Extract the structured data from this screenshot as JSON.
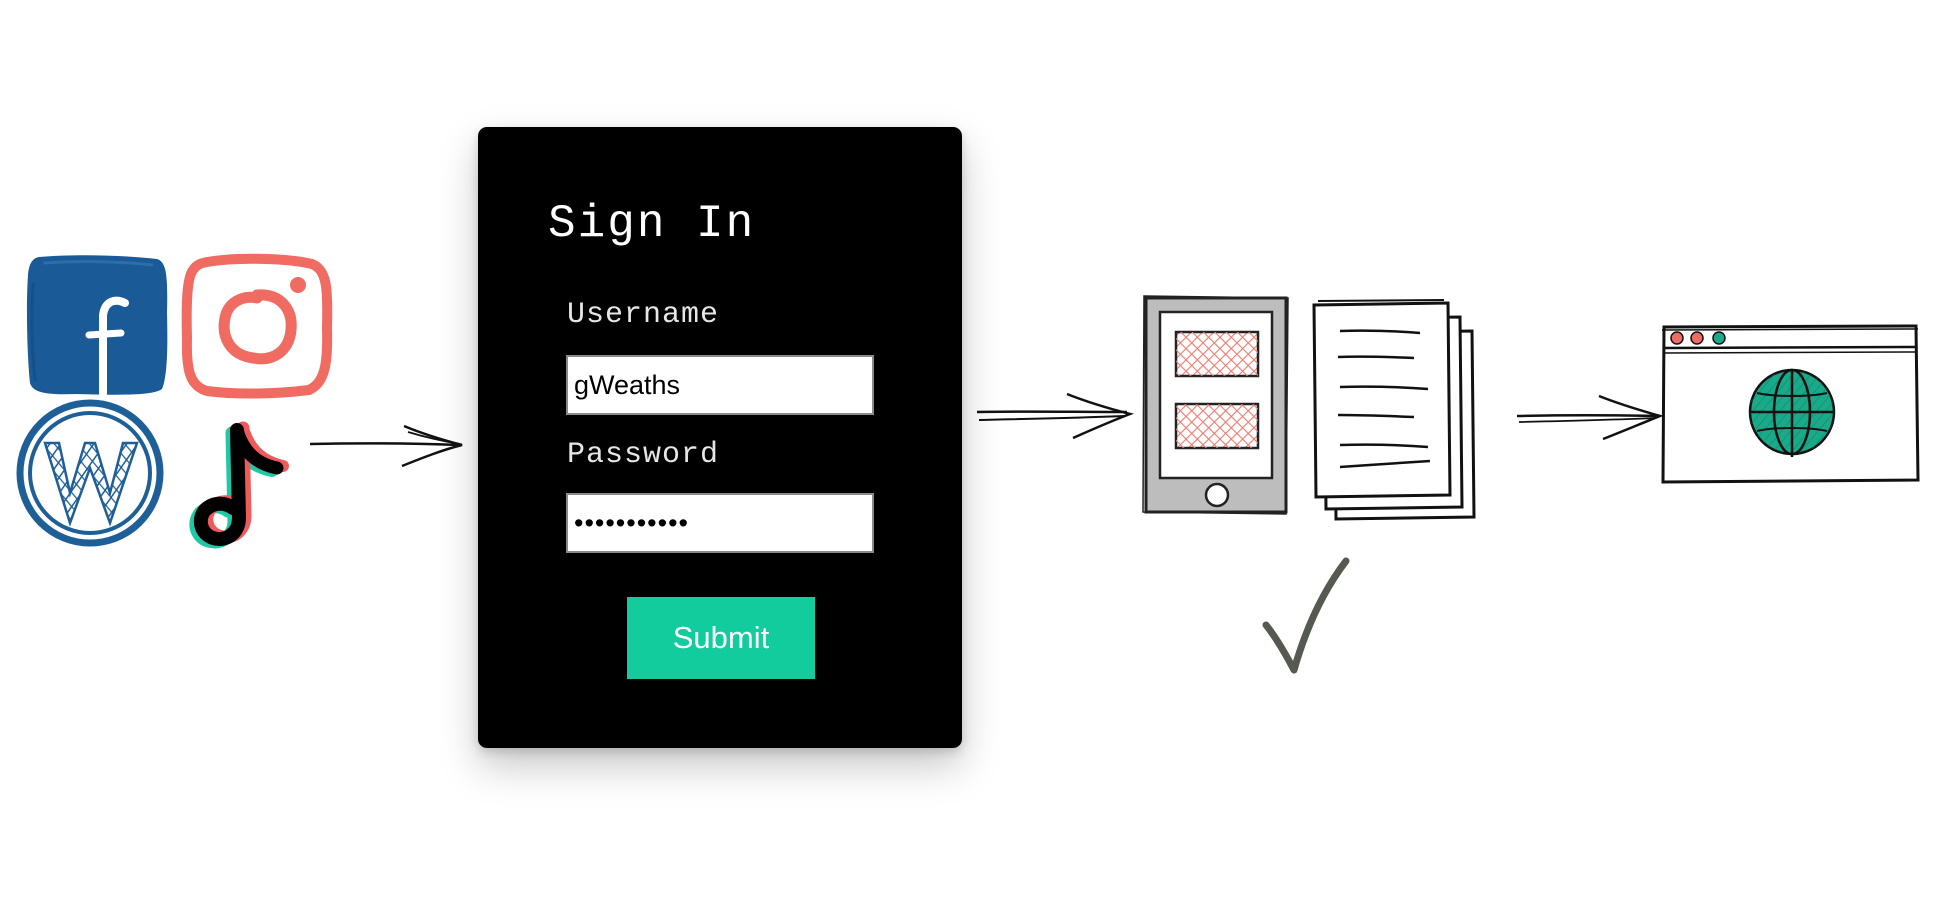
{
  "signin": {
    "title": "Sign In",
    "username_label": "Username",
    "username_value": "gWeaths",
    "password_label": "Password",
    "password_value": "•••••••••••",
    "submit_label": "Submit"
  },
  "icons": {
    "social": [
      "facebook-icon",
      "instagram-icon",
      "wordpress-icon",
      "tiktok-icon"
    ],
    "flow": [
      "arrow-right-icon",
      "tablet-icon",
      "documents-icon",
      "checkmark-icon",
      "browser-window-icon",
      "globe-icon"
    ]
  },
  "colors": {
    "facebook": "#1a5a96",
    "instagram": "#f06b62",
    "wordpress": "#1f5f98",
    "tiktok_black": "#000000",
    "tiktok_teal": "#1ecaa6",
    "tiktok_red": "#f05a5a",
    "card": "#000000",
    "submit": "#12cc9e",
    "tablet_content": "#f07a70",
    "globe": "#1aaa8a",
    "checkmark": "#555a50"
  }
}
